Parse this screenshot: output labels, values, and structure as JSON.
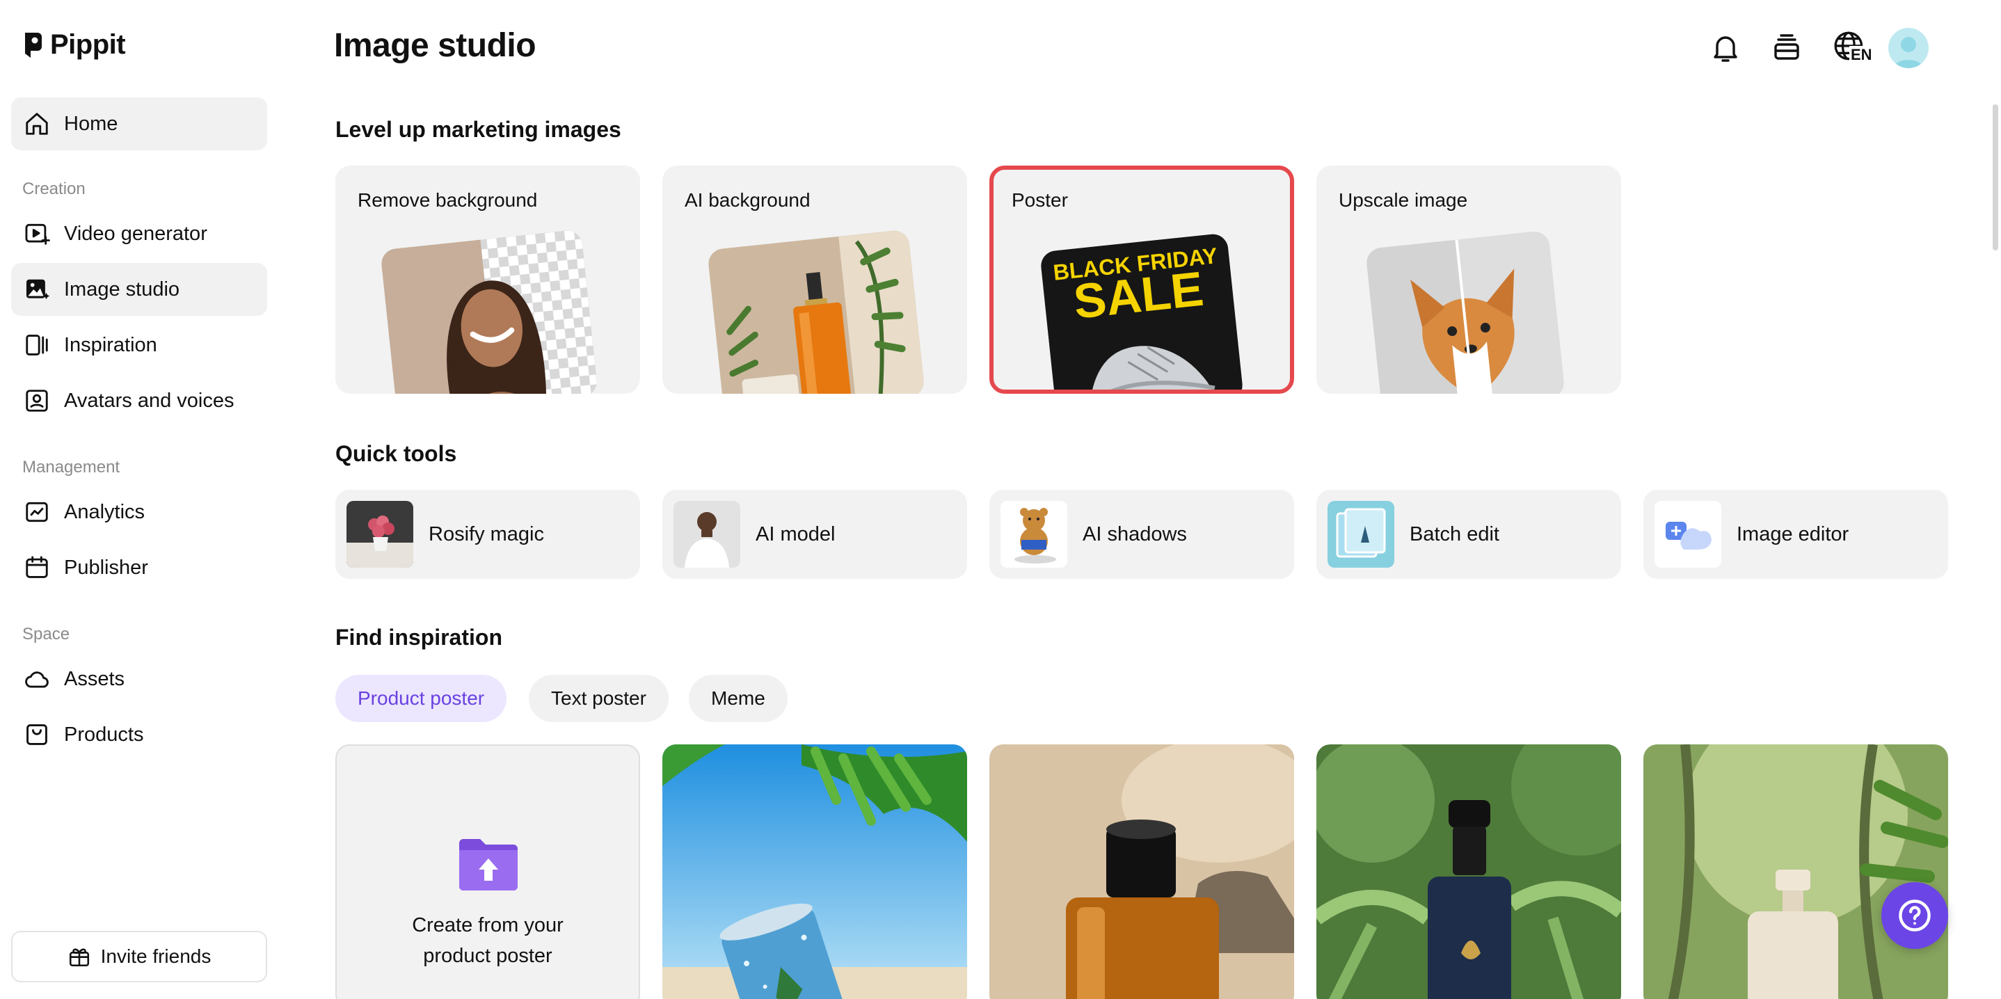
{
  "app": {
    "name": "Pippit"
  },
  "sidebar": {
    "home": "Home",
    "sections": {
      "creation": "Creation",
      "management": "Management",
      "space": "Space"
    },
    "items": {
      "video_generator": "Video generator",
      "image_studio": "Image studio",
      "inspiration": "Inspiration",
      "avatars": "Avatars and voices",
      "analytics": "Analytics",
      "publisher": "Publisher",
      "assets": "Assets",
      "products": "Products"
    },
    "invite": "Invite friends"
  },
  "header": {
    "title": "Image studio",
    "language": "EN"
  },
  "marketing": {
    "title": "Level up marketing images",
    "cards": [
      "Remove background",
      "AI background",
      "Poster",
      "Upscale image"
    ],
    "poster_text": {
      "line1": "BLACK FRIDAY",
      "line2": "SALE"
    }
  },
  "quick_tools": {
    "title": "Quick tools",
    "items": [
      "Rosify magic",
      "AI model",
      "AI shadows",
      "Batch edit",
      "Image editor"
    ]
  },
  "inspiration": {
    "title": "Find inspiration",
    "chips": [
      "Product poster",
      "Text poster",
      "Meme"
    ],
    "upload_line1": "Create from your",
    "upload_line2": "product poster"
  },
  "colors": {
    "accent": "#6b45e6",
    "selected_border": "#e5484d",
    "chip_active_bg": "#ece7ff",
    "card_bg": "#f2f2f2"
  }
}
